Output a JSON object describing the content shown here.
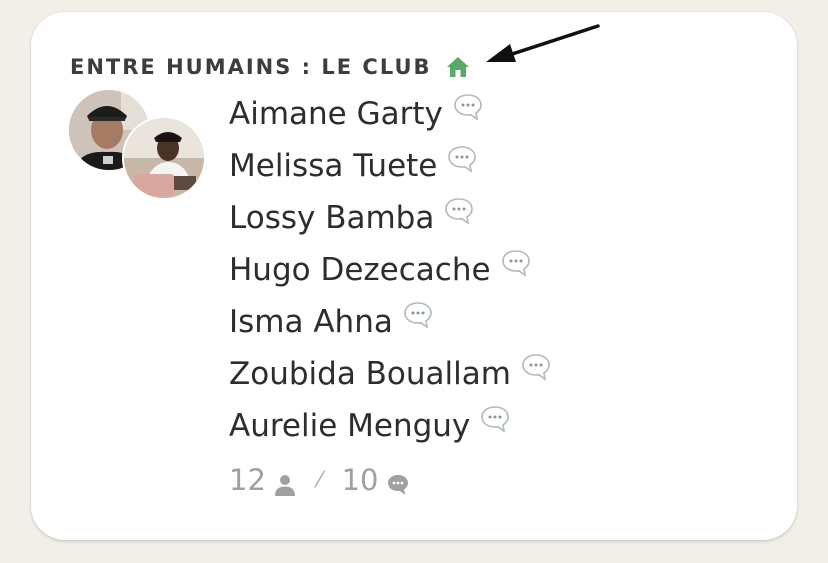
{
  "club": {
    "title": "ENTRE HUMAINS : LE CLUB",
    "home_icon": "home-icon",
    "accent_color": "#5aa966"
  },
  "members": [
    {
      "name": "Aimane Garty"
    },
    {
      "name": "Melissa Tuete"
    },
    {
      "name": "Lossy Bamba"
    },
    {
      "name": "Hugo Dezecache"
    },
    {
      "name": "Isma Ahna"
    },
    {
      "name": "Zoubida Bouallam"
    },
    {
      "name": "Aurelie Menguy"
    }
  ],
  "stats": {
    "members_count": "12",
    "members_icon": "person-icon",
    "separator": "⁄",
    "messages_count": "10",
    "messages_icon": "speech-bubble-icon"
  }
}
